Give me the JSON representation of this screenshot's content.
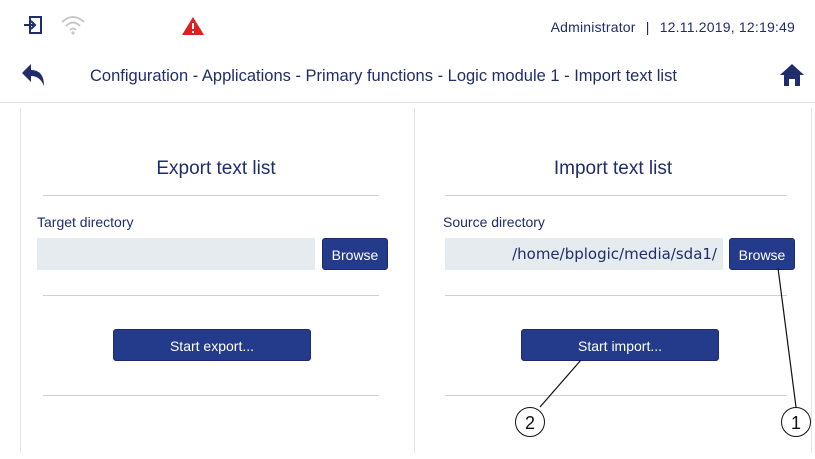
{
  "status_bar": {
    "user": "Administrator",
    "separator": "|",
    "datetime": "12.11.2019, 12:19:49",
    "icons": {
      "login": "login-icon",
      "wifi": "wifi-icon",
      "warning": "warning-icon"
    },
    "warning_color": "#e02020"
  },
  "navigation": {
    "back_icon": "back-arrow-icon",
    "breadcrumb": "Configuration - Applications - Primary functions - Logic module 1 - Import text list",
    "home_icon": "home-icon"
  },
  "export_panel": {
    "title": "Export text list",
    "field_label": "Target directory",
    "field_value": "",
    "browse_label": "Browse",
    "action_label": "Start export..."
  },
  "import_panel": {
    "title": "Import text list",
    "field_label": "Source directory",
    "field_value": "/home/bplogic/media/sda1/",
    "browse_label": "Browse",
    "action_label": "Start import..."
  },
  "callouts": {
    "one": "1",
    "two": "2"
  },
  "colors": {
    "primary": "#243a8a",
    "text": "#1f2d6b",
    "field_bg": "#e6ebf0"
  }
}
